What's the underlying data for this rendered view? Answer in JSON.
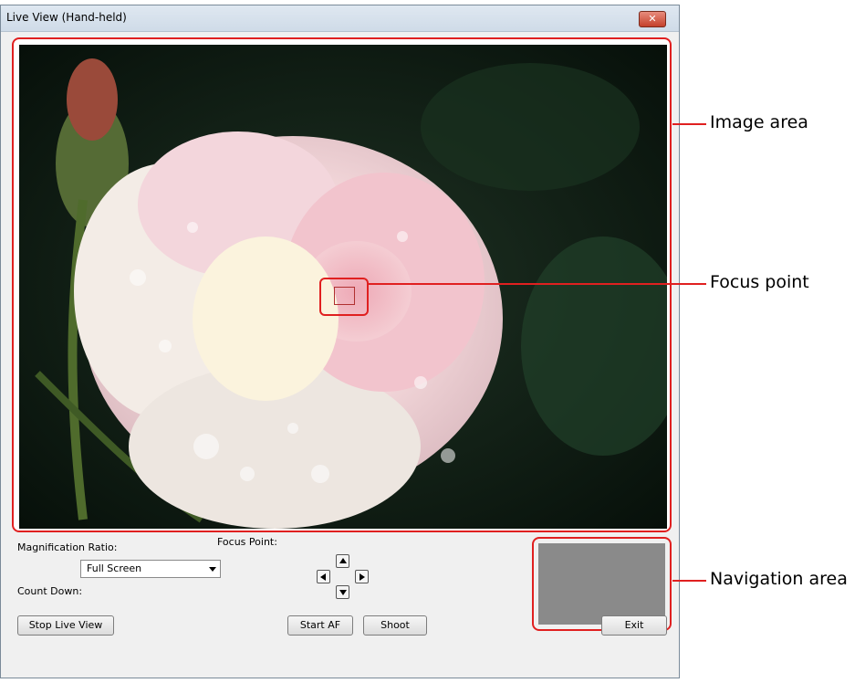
{
  "window": {
    "title": "Live View (Hand-held)",
    "close_icon": "close-icon"
  },
  "controls": {
    "magnification_label": "Magnification Ratio:",
    "magnification_value": "Full Screen",
    "focus_point_label": "Focus Point:",
    "count_down_label": "Count Down:"
  },
  "buttons": {
    "stop_live_view": "Stop Live View",
    "start_af": "Start AF",
    "shoot": "Shoot",
    "exit": "Exit"
  },
  "callouts": {
    "image_area": "Image area",
    "focus_point": "Focus point",
    "navigation_area": "Navigation area"
  },
  "colors": {
    "callout_red": "#e02020",
    "navigation_gray": "#8a8a8a"
  }
}
